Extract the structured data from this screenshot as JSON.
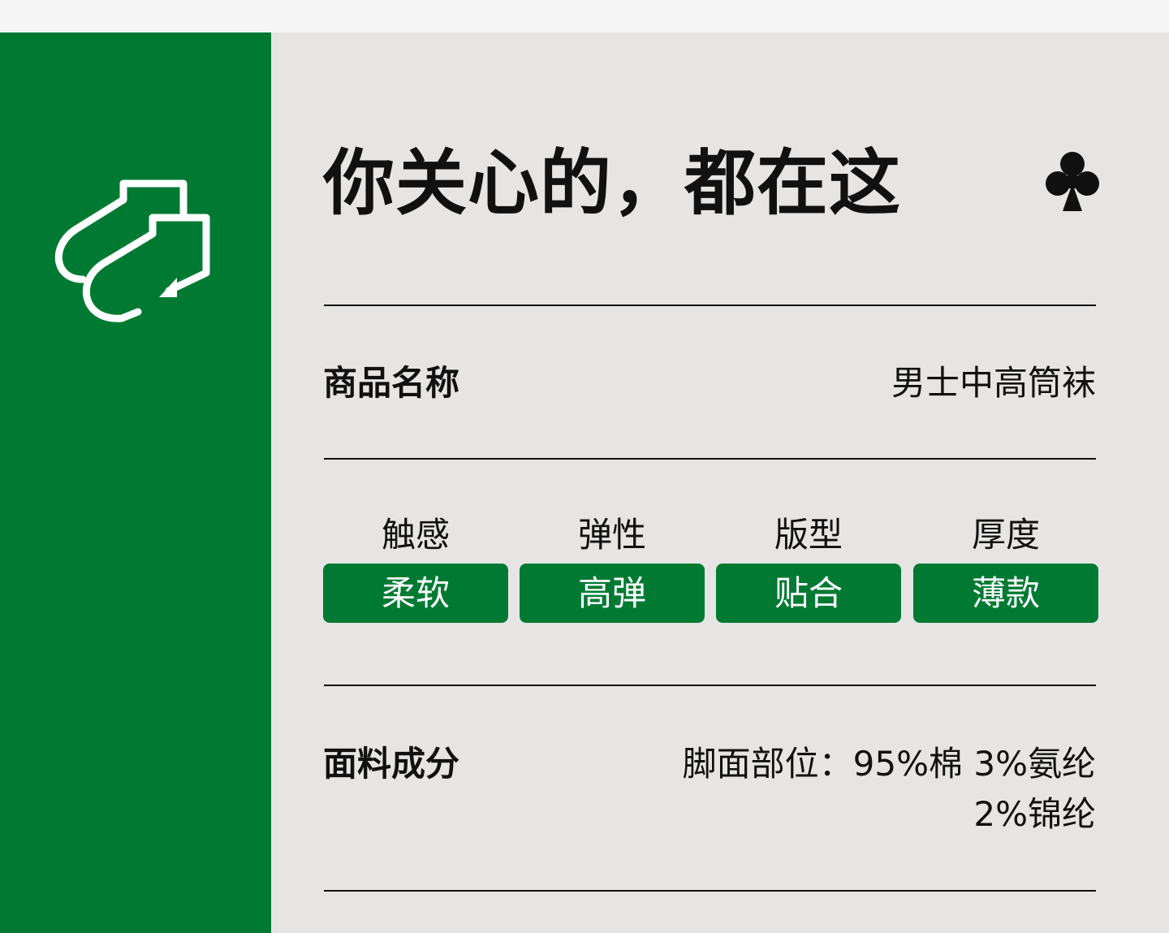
{
  "title": "你关心的，都在这",
  "icons": {
    "sidebar": "sock-icon",
    "corner": "club-suit-icon"
  },
  "colors": {
    "brand_green": "#007a33",
    "panel": "#e6e5e3",
    "text": "#111111"
  },
  "product": {
    "label": "商品名称",
    "value": "男士中高筒袜"
  },
  "attributes": [
    {
      "label": "触感",
      "value": "柔软"
    },
    {
      "label": "弹性",
      "value": "高弹"
    },
    {
      "label": "版型",
      "value": "贴合"
    },
    {
      "label": "厚度",
      "value": "薄款"
    }
  ],
  "fabric": {
    "label": "面料成分",
    "lines": [
      "脚面部位：95%棉  3%氨纶",
      "2%锦纶"
    ]
  }
}
